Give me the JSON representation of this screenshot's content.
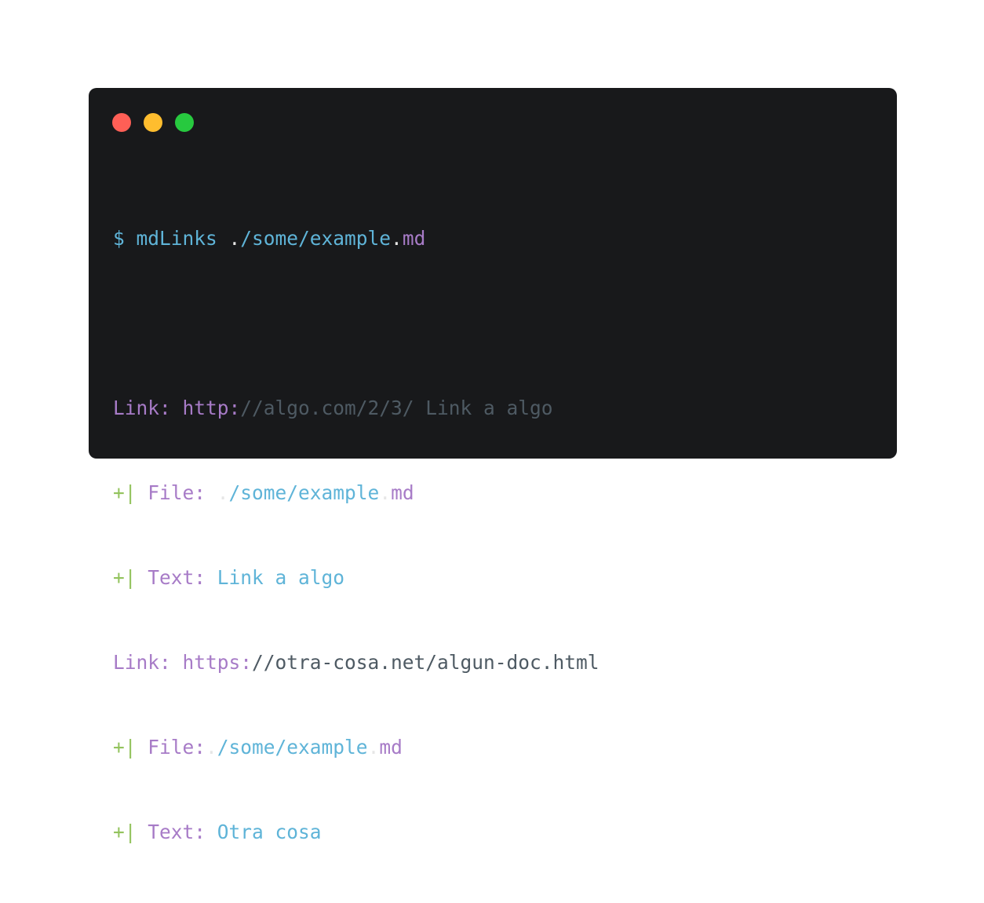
{
  "colors": {
    "background": "#18191b",
    "cyan": "#5fb4d8",
    "purple": "#a77bc7",
    "gray": "#4e5a63",
    "green": "#93c35d",
    "white": "#e6e6e6",
    "close": "#ff5f56",
    "minimize": "#ffbd2e",
    "maximize": "#27c93f"
  },
  "window": {
    "buttons": [
      "close",
      "minimize",
      "maximize"
    ]
  },
  "command": {
    "prompt": "$ mdLinks ",
    "dot1": ".",
    "path": "/some/example",
    "dot2": ".",
    "ext": "md"
  },
  "output": {
    "link1": {
      "label": "Link: ",
      "scheme": "http:",
      "rest": "//algo.com/2/3/ Link a algo"
    },
    "file1": {
      "marker": "+|",
      "label": " File: ",
      "dot1": ".",
      "path": "/some/example",
      "dot2": ".",
      "ext": "md"
    },
    "text1": {
      "marker": "+|",
      "label": " Text: ",
      "value": "Link a algo"
    },
    "link2": {
      "label": "Link: ",
      "scheme": "https:",
      "rest": "//otra-cosa.net/algun-doc.html"
    },
    "file2": {
      "marker": "+|",
      "label": " File:",
      "dot1": ".",
      "path": "/some/example",
      "dot2": ".",
      "ext": "md"
    },
    "text2": {
      "marker": "+|",
      "label": " Text: ",
      "value": "Otra cosa"
    }
  }
}
